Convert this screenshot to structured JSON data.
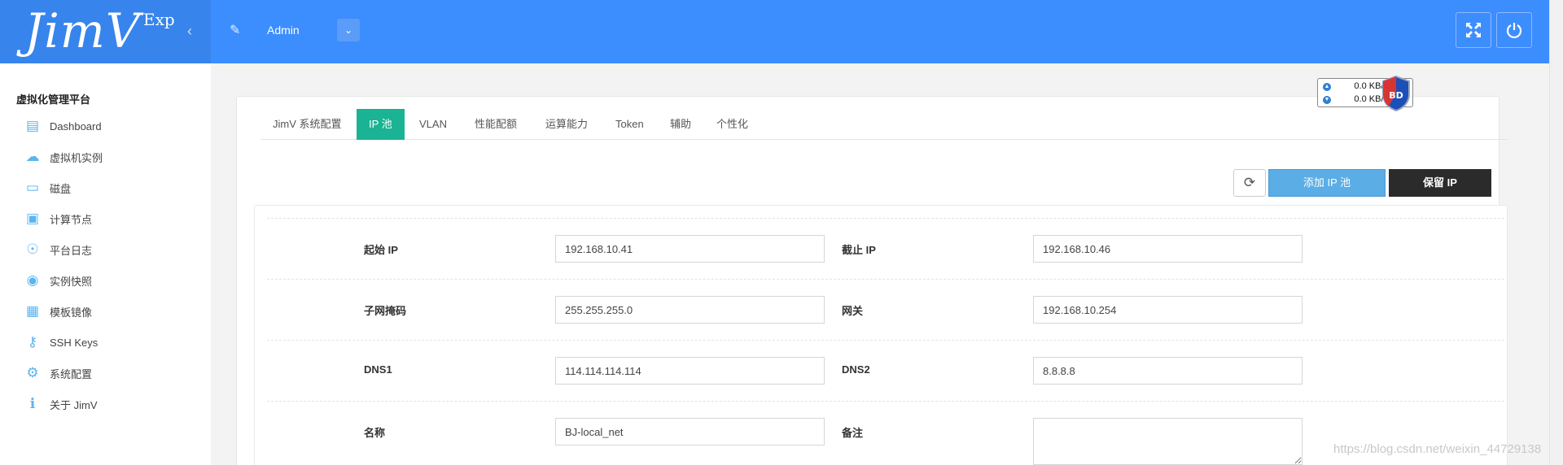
{
  "app": {
    "logo_text": "JimV",
    "logo_suffix": "Exp",
    "user_name": "Admin"
  },
  "sidebar": {
    "title": "虚拟化管理平台",
    "items": [
      {
        "label": "Dashboard",
        "icon": "dashboard-icon"
      },
      {
        "label": "虚拟机实例",
        "icon": "cloud-icon"
      },
      {
        "label": "磁盘",
        "icon": "disk-icon"
      },
      {
        "label": "计算节点",
        "icon": "monitor-icon"
      },
      {
        "label": "平台日志",
        "icon": "eye-icon"
      },
      {
        "label": "实例快照",
        "icon": "camera-icon"
      },
      {
        "label": "模板镜像",
        "icon": "inbox-icon"
      },
      {
        "label": "SSH Keys",
        "icon": "key-icon"
      },
      {
        "label": "系统配置",
        "icon": "gear-icon"
      },
      {
        "label": "关于 JimV",
        "icon": "info-icon"
      }
    ]
  },
  "tabs": [
    {
      "label": "JimV 系统配置",
      "active": false
    },
    {
      "label": "IP 池",
      "active": true
    },
    {
      "label": "VLAN",
      "active": false
    },
    {
      "label": "性能配额",
      "active": false
    },
    {
      "label": "运算能力",
      "active": false
    },
    {
      "label": "Token",
      "active": false
    },
    {
      "label": "辅助",
      "active": false
    },
    {
      "label": "个性化",
      "active": false
    }
  ],
  "net_widget": {
    "up": "0.0 KB/s",
    "down": "0.0 KB/s",
    "badge": "BD"
  },
  "toolbar": {
    "add_label": "添加 IP 池",
    "reserve_label": "保留 IP"
  },
  "form": {
    "start_ip": {
      "label": "起始 IP",
      "value": "192.168.10.41"
    },
    "end_ip": {
      "label": "截止 IP",
      "value": "192.168.10.46"
    },
    "netmask": {
      "label": "子网掩码",
      "value": "255.255.255.0"
    },
    "gateway": {
      "label": "网关",
      "value": "192.168.10.254"
    },
    "dns1": {
      "label": "DNS1",
      "value": "114.114.114.114"
    },
    "dns2": {
      "label": "DNS2",
      "value": "8.8.8.8"
    },
    "name": {
      "label": "名称",
      "value": "BJ-local_net"
    },
    "remark": {
      "label": "备注",
      "value": ""
    }
  },
  "watermark": "https://blog.csdn.net/weixin_44729138",
  "colors": {
    "header": "#3c8dfe",
    "logo_bg": "#3784ed",
    "active_tab": "#1ab394",
    "add_button": "#5bade5",
    "reserve_button": "#2b2b2b",
    "sidebar_icon": "#5ab4f0"
  }
}
